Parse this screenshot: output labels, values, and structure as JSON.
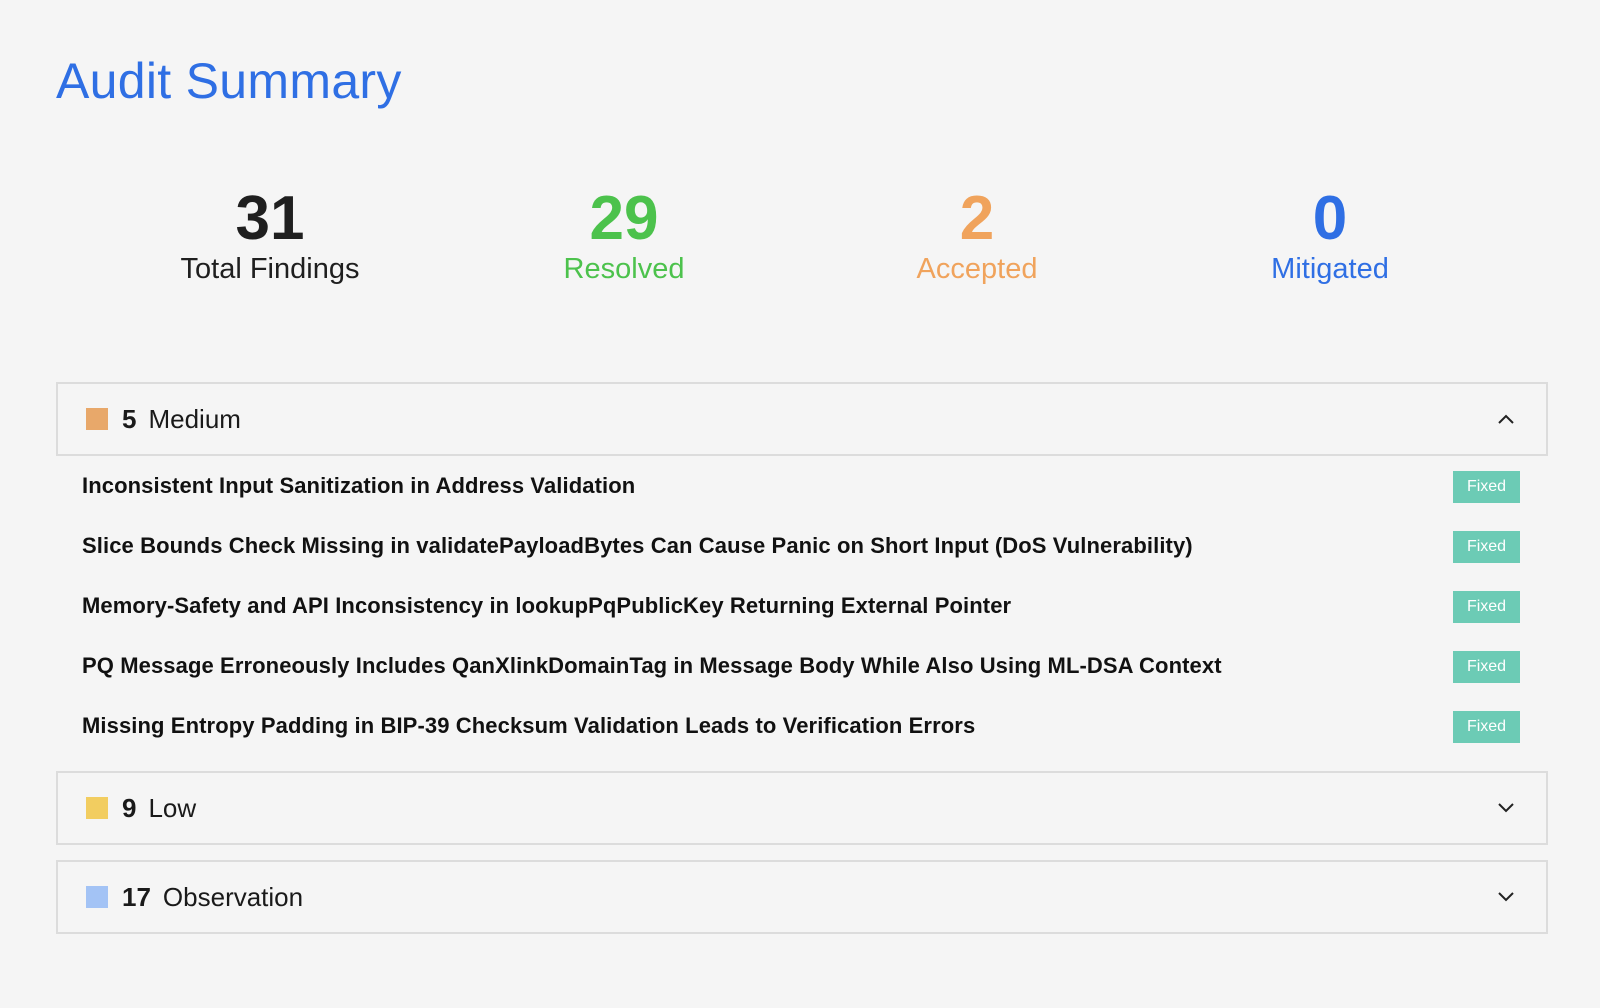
{
  "page": {
    "title": "Audit Summary"
  },
  "stats": {
    "total": {
      "value": "31",
      "label": "Total Findings"
    },
    "resolved": {
      "value": "29",
      "label": "Resolved"
    },
    "accepted": {
      "value": "2",
      "label": "Accepted"
    },
    "mitigated": {
      "value": "0",
      "label": "Mitigated"
    }
  },
  "colors": {
    "title": "#2f6fe4",
    "resolved": "#4cc24c",
    "accepted": "#f0a35c",
    "mitigated": "#2f6fe4",
    "medium": "#e8a86a",
    "low": "#f2cd60",
    "observation": "#a3c3f5",
    "fixed_badge": "#6ccbb5"
  },
  "sections": [
    {
      "count": "5",
      "name": "Medium",
      "expanded": true,
      "chevron_icon": "chevron-up-icon",
      "findings": [
        {
          "title": "Inconsistent Input Sanitization in Address Validation",
          "status": "Fixed"
        },
        {
          "title": "Slice Bounds Check Missing in validatePayloadBytes Can Cause Panic on Short Input (DoS Vulnerability)",
          "status": "Fixed"
        },
        {
          "title": "Memory-Safety and API Inconsistency in lookupPqPublicKey Returning External Pointer",
          "status": "Fixed"
        },
        {
          "title": "PQ Message Erroneously Includes QanXlinkDomainTag in Message Body While Also Using ML-DSA Context",
          "status": "Fixed"
        },
        {
          "title": "Missing Entropy Padding in BIP-39 Checksum Validation Leads to Verification Errors",
          "status": "Fixed"
        }
      ]
    },
    {
      "count": "9",
      "name": "Low",
      "expanded": false,
      "chevron_icon": "chevron-down-icon"
    },
    {
      "count": "17",
      "name": "Observation",
      "expanded": false,
      "chevron_icon": "chevron-down-icon"
    }
  ]
}
